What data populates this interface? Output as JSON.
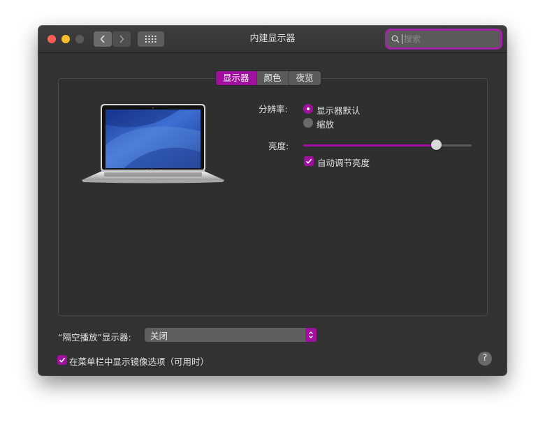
{
  "window": {
    "title": "内建显示器",
    "search_placeholder": "搜索"
  },
  "tabs": [
    {
      "label": "显示器",
      "active": true
    },
    {
      "label": "颜色",
      "active": false
    },
    {
      "label": "夜览",
      "active": false
    }
  ],
  "display": {
    "resolution_label": "分辨率:",
    "resolution_options": [
      {
        "label": "显示器默认",
        "selected": true
      },
      {
        "label": "缩放",
        "selected": false
      }
    ],
    "brightness_label": "亮度:",
    "brightness_level": 0.79,
    "auto_brightness_label": "自动调节亮度",
    "auto_brightness_checked": true
  },
  "airplay": {
    "label": "“隔空播放”显示器:",
    "value": "关闭"
  },
  "mirror_option": {
    "label": "在菜单栏中显示镜像选项（可用时）",
    "checked": true
  },
  "help": {
    "label": "?"
  },
  "colors": {
    "accent": "#a0109f",
    "window_bg": "#323232"
  }
}
